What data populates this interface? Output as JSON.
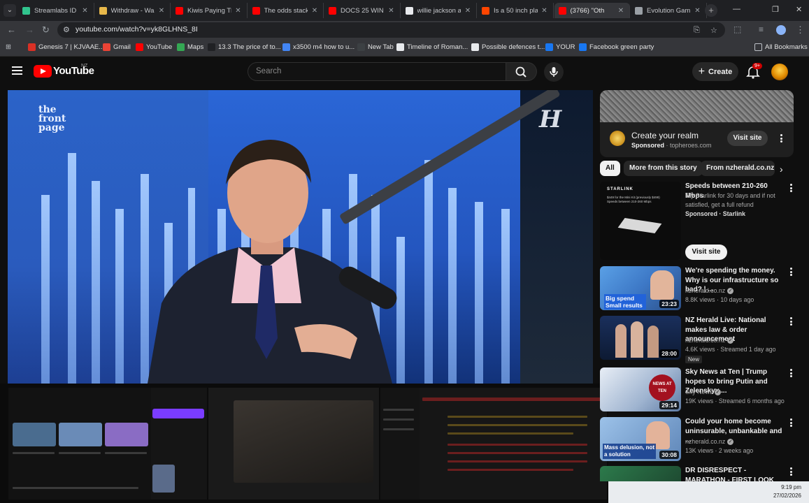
{
  "browser": {
    "tabs": [
      {
        "label": "Streamlabs ID -",
        "color": "#31c48d"
      },
      {
        "label": "Withdraw - Wall",
        "color": "#e8b84a"
      },
      {
        "label": "Kiwis Paying Tho",
        "color": "#ff0000"
      },
      {
        "label": "The odds stacke",
        "color": "#ff0000"
      },
      {
        "label": "DOCS 25 WIN",
        "color": "#ff0000"
      },
      {
        "label": "willie jackson ag",
        "color": "#e8eaed"
      },
      {
        "label": "Is a 50 inch plas",
        "color": "#ff4500"
      },
      {
        "label": "(3766) \"Oth",
        "color": "#ff0000"
      },
      {
        "label": "Evolution Gam",
        "color": "#9aa0a6"
      }
    ],
    "url": "youtube.com/watch?v=yk8GLHNS_8I",
    "bookmarks": [
      {
        "label": "Genesis 7 | KJVAAE...",
        "color": "#d93025"
      },
      {
        "label": "Gmail",
        "color": "#ea4335"
      },
      {
        "label": "YouTube",
        "color": "#ff0000"
      },
      {
        "label": "Maps",
        "color": "#34a853"
      },
      {
        "label": "13.3 The price of to...",
        "color": "#202124"
      },
      {
        "label": "x3500 m4 how to u...",
        "color": "#4285f4"
      },
      {
        "label": "New Tab",
        "color": "#3c4043"
      },
      {
        "label": "Timeline of Roman...",
        "color": "#e8eaed"
      },
      {
        "label": "Possible defences t...",
        "color": "#e8eaed"
      },
      {
        "label": "YOUR",
        "color": "#1877f2"
      },
      {
        "label": "Facebook green party",
        "color": "#1877f2"
      }
    ],
    "all_bookmarks": "All Bookmarks"
  },
  "youtube": {
    "brand": "YouTube",
    "region": "NZ",
    "search_placeholder": "Search",
    "create_label": "Create",
    "notification_count": "9+"
  },
  "player": {
    "watermark_left": "the front page",
    "watermark_right": "H"
  },
  "sidebar": {
    "ad": {
      "title": "Create your realm",
      "sponsored": "Sponsored",
      "advertiser": "topheroes.com",
      "cta": "Visit site"
    },
    "chips": [
      "All",
      "More from this story",
      "From nzherald.co.nz"
    ],
    "videos": [
      {
        "title": "Speeds between 210-260 Mbps",
        "line2": "Try Starlink for 30 days and if not satisfied, get a full refund",
        "line3": "Sponsored · Starlink",
        "cta": "Visit site",
        "thumb_label": "STARLINK",
        "thumb_text": "$449 for the Mini Kit (previously $499) Speeds between 210-260 Mbps"
      },
      {
        "title": "We're spending the money. Why is our infrastructure so bad? | ...",
        "channel": "nzherald.co.nz",
        "stats": "8.8K views · 10 days ago",
        "duration": "23:23",
        "thumb_text": "Big spend Small results"
      },
      {
        "title": "NZ Herald Live: National makes law & order announcement",
        "channel": "nzherald.co.nz",
        "stats": "4.6K views · Streamed 1 day ago",
        "badge": "New",
        "duration": "28:00"
      },
      {
        "title": "Sky News at Ten | Trump hopes to bring Putin and Zelenskyy ...",
        "channel": "Sky News",
        "stats": "19K views · Streamed 6 months ago",
        "duration": "29:14",
        "thumb_text": "NEWS AT TEN"
      },
      {
        "title": "Could your home become uninsurable, unbankable and ...",
        "channel": "nzherald.co.nz",
        "stats": "13K views · 2 weeks ago",
        "duration": "30:08",
        "thumb_text": "Mass delusion, not a solution"
      },
      {
        "title": "DR DISRESPECT - MARATHON - FIRST LOOK GAMEPLAY",
        "channel": "",
        "stats": ""
      }
    ]
  },
  "taskbar": {
    "time": "9:19 pm",
    "date": "27/02/2026"
  }
}
